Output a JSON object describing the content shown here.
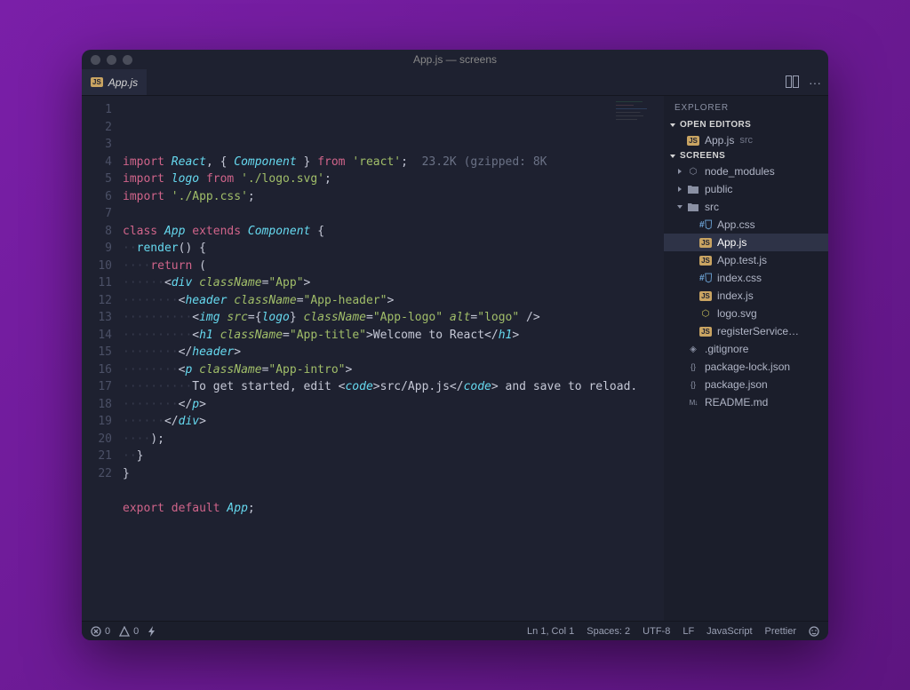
{
  "window": {
    "title": "App.js — screens"
  },
  "tabs": {
    "active": {
      "filename": "App.js",
      "icon": "js"
    }
  },
  "editor_actions": {
    "split": "▢▢",
    "more": "···"
  },
  "code": {
    "size_hint": "23.2K (gzipped: 8K",
    "lines": [
      [
        {
          "t": "kw",
          "v": "import"
        },
        {
          "t": "sp"
        },
        {
          "t": "id",
          "v": "React"
        },
        {
          "t": "punc",
          "v": ", { "
        },
        {
          "t": "id",
          "v": "Component"
        },
        {
          "t": "punc",
          "v": " } "
        },
        {
          "t": "kw",
          "v": "from"
        },
        {
          "t": "sp"
        },
        {
          "t": "str",
          "v": "'react'"
        },
        {
          "t": "punc",
          "v": ";"
        },
        {
          "t": "sp2"
        },
        {
          "t": "hint",
          "v": "23.2K (gzipped: 8K"
        }
      ],
      [
        {
          "t": "kw",
          "v": "import"
        },
        {
          "t": "sp"
        },
        {
          "t": "id",
          "v": "logo"
        },
        {
          "t": "sp"
        },
        {
          "t": "kw",
          "v": "from"
        },
        {
          "t": "sp"
        },
        {
          "t": "str",
          "v": "'./logo.svg'"
        },
        {
          "t": "punc",
          "v": ";"
        }
      ],
      [
        {
          "t": "kw",
          "v": "import"
        },
        {
          "t": "sp"
        },
        {
          "t": "str",
          "v": "'./App.css'"
        },
        {
          "t": "punc",
          "v": ";"
        }
      ],
      [],
      [
        {
          "t": "kw",
          "v": "class"
        },
        {
          "t": "sp"
        },
        {
          "t": "id",
          "v": "App"
        },
        {
          "t": "sp"
        },
        {
          "t": "kw",
          "v": "extends"
        },
        {
          "t": "sp"
        },
        {
          "t": "id",
          "v": "Component"
        },
        {
          "t": "sp"
        },
        {
          "t": "brace",
          "v": "{"
        }
      ],
      [
        {
          "t": "ind",
          "n": 1
        },
        {
          "t": "fn",
          "v": "render"
        },
        {
          "t": "punc",
          "v": "() "
        },
        {
          "t": "brace",
          "v": "{"
        }
      ],
      [
        {
          "t": "ind",
          "n": 2
        },
        {
          "t": "kw",
          "v": "return"
        },
        {
          "t": "punc",
          "v": " ("
        }
      ],
      [
        {
          "t": "ind",
          "n": 3
        },
        {
          "t": "punc",
          "v": "<"
        },
        {
          "t": "tagname",
          "v": "div"
        },
        {
          "t": "sp"
        },
        {
          "t": "attr",
          "v": "className"
        },
        {
          "t": "punc",
          "v": "="
        },
        {
          "t": "str",
          "v": "\"App\""
        },
        {
          "t": "punc",
          "v": ">"
        }
      ],
      [
        {
          "t": "ind",
          "n": 4
        },
        {
          "t": "punc",
          "v": "<"
        },
        {
          "t": "tagname",
          "v": "header"
        },
        {
          "t": "sp"
        },
        {
          "t": "attr",
          "v": "className"
        },
        {
          "t": "punc",
          "v": "="
        },
        {
          "t": "str",
          "v": "\"App-header\""
        },
        {
          "t": "punc",
          "v": ">"
        }
      ],
      [
        {
          "t": "ind",
          "n": 5
        },
        {
          "t": "punc",
          "v": "<"
        },
        {
          "t": "tagname",
          "v": "img"
        },
        {
          "t": "sp"
        },
        {
          "t": "attr",
          "v": "src"
        },
        {
          "t": "punc",
          "v": "={"
        },
        {
          "t": "id",
          "v": "logo"
        },
        {
          "t": "punc",
          "v": "} "
        },
        {
          "t": "attr",
          "v": "className"
        },
        {
          "t": "punc",
          "v": "="
        },
        {
          "t": "str",
          "v": "\"App-logo\""
        },
        {
          "t": "sp"
        },
        {
          "t": "attr",
          "v": "alt"
        },
        {
          "t": "punc",
          "v": "="
        },
        {
          "t": "str",
          "v": "\"logo\""
        },
        {
          "t": "punc",
          "v": " />"
        }
      ],
      [
        {
          "t": "ind",
          "n": 5
        },
        {
          "t": "punc",
          "v": "<"
        },
        {
          "t": "tagname",
          "v": "h1"
        },
        {
          "t": "sp"
        },
        {
          "t": "attr",
          "v": "className"
        },
        {
          "t": "punc",
          "v": "="
        },
        {
          "t": "str",
          "v": "\"App-title\""
        },
        {
          "t": "punc",
          "v": ">"
        },
        {
          "t": "txt",
          "v": "Welcome to React"
        },
        {
          "t": "punc",
          "v": "</"
        },
        {
          "t": "tagname",
          "v": "h1"
        },
        {
          "t": "punc",
          "v": ">"
        }
      ],
      [
        {
          "t": "ind",
          "n": 4
        },
        {
          "t": "punc",
          "v": "</"
        },
        {
          "t": "tagname",
          "v": "header"
        },
        {
          "t": "punc",
          "v": ">"
        }
      ],
      [
        {
          "t": "ind",
          "n": 4
        },
        {
          "t": "punc",
          "v": "<"
        },
        {
          "t": "tagname",
          "v": "p"
        },
        {
          "t": "sp"
        },
        {
          "t": "attr",
          "v": "className"
        },
        {
          "t": "punc",
          "v": "="
        },
        {
          "t": "str",
          "v": "\"App-intro\""
        },
        {
          "t": "punc",
          "v": ">"
        }
      ],
      [
        {
          "t": "ind",
          "n": 5
        },
        {
          "t": "txt",
          "v": "To get started, edit "
        },
        {
          "t": "punc",
          "v": "<"
        },
        {
          "t": "tagname",
          "v": "code"
        },
        {
          "t": "punc",
          "v": ">"
        },
        {
          "t": "txt",
          "v": "src/App.js"
        },
        {
          "t": "punc",
          "v": "</"
        },
        {
          "t": "tagname",
          "v": "code"
        },
        {
          "t": "punc",
          "v": ">"
        },
        {
          "t": "txt",
          "v": " and save to reload."
        }
      ],
      [
        {
          "t": "ind",
          "n": 4
        },
        {
          "t": "punc",
          "v": "</"
        },
        {
          "t": "tagname",
          "v": "p"
        },
        {
          "t": "punc",
          "v": ">"
        }
      ],
      [
        {
          "t": "ind",
          "n": 3
        },
        {
          "t": "punc",
          "v": "</"
        },
        {
          "t": "tagname",
          "v": "div"
        },
        {
          "t": "punc",
          "v": ">"
        }
      ],
      [
        {
          "t": "ind",
          "n": 2
        },
        {
          "t": "punc",
          "v": ");"
        }
      ],
      [
        {
          "t": "ind",
          "n": 1
        },
        {
          "t": "brace",
          "v": "}"
        }
      ],
      [
        {
          "t": "brace",
          "v": "}"
        }
      ],
      [],
      [
        {
          "t": "kw",
          "v": "export"
        },
        {
          "t": "sp"
        },
        {
          "t": "kw",
          "v": "default"
        },
        {
          "t": "sp"
        },
        {
          "t": "id",
          "v": "App"
        },
        {
          "t": "punc",
          "v": ";"
        }
      ],
      []
    ]
  },
  "explorer": {
    "title": "EXPLORER",
    "sections": [
      {
        "label": "OPEN EDITORS",
        "items": [
          {
            "icon": "js",
            "name": "App.js",
            "hint": "src",
            "depth": 1
          }
        ]
      },
      {
        "label": "SCREENS",
        "items": [
          {
            "icon": "nm",
            "name": "node_modules",
            "folder": true,
            "depth": 1,
            "chev": "closed"
          },
          {
            "icon": "folder",
            "name": "public",
            "folder": true,
            "depth": 1,
            "chev": "closed"
          },
          {
            "icon": "folder",
            "name": "src",
            "folder": true,
            "depth": 1,
            "chev": "open"
          },
          {
            "icon": "css",
            "name": "App.css",
            "depth": 2
          },
          {
            "icon": "js",
            "name": "App.js",
            "depth": 2,
            "selected": true
          },
          {
            "icon": "js",
            "name": "App.test.js",
            "depth": 2
          },
          {
            "icon": "css",
            "name": "index.css",
            "depth": 2
          },
          {
            "icon": "js",
            "name": "index.js",
            "depth": 2
          },
          {
            "icon": "svg",
            "name": "logo.svg",
            "depth": 2
          },
          {
            "icon": "js",
            "name": "registerService…",
            "depth": 2
          },
          {
            "icon": "git",
            "name": ".gitignore",
            "depth": 1
          },
          {
            "icon": "json",
            "name": "package-lock.json",
            "depth": 1
          },
          {
            "icon": "json",
            "name": "package.json",
            "depth": 1
          },
          {
            "icon": "md",
            "name": "README.md",
            "depth": 1
          }
        ]
      }
    ]
  },
  "status": {
    "errors": "0",
    "warnings": "0",
    "position": "Ln 1, Col 1",
    "spaces": "Spaces: 2",
    "encoding": "UTF-8",
    "eol": "LF",
    "language": "JavaScript",
    "formatter": "Prettier"
  }
}
